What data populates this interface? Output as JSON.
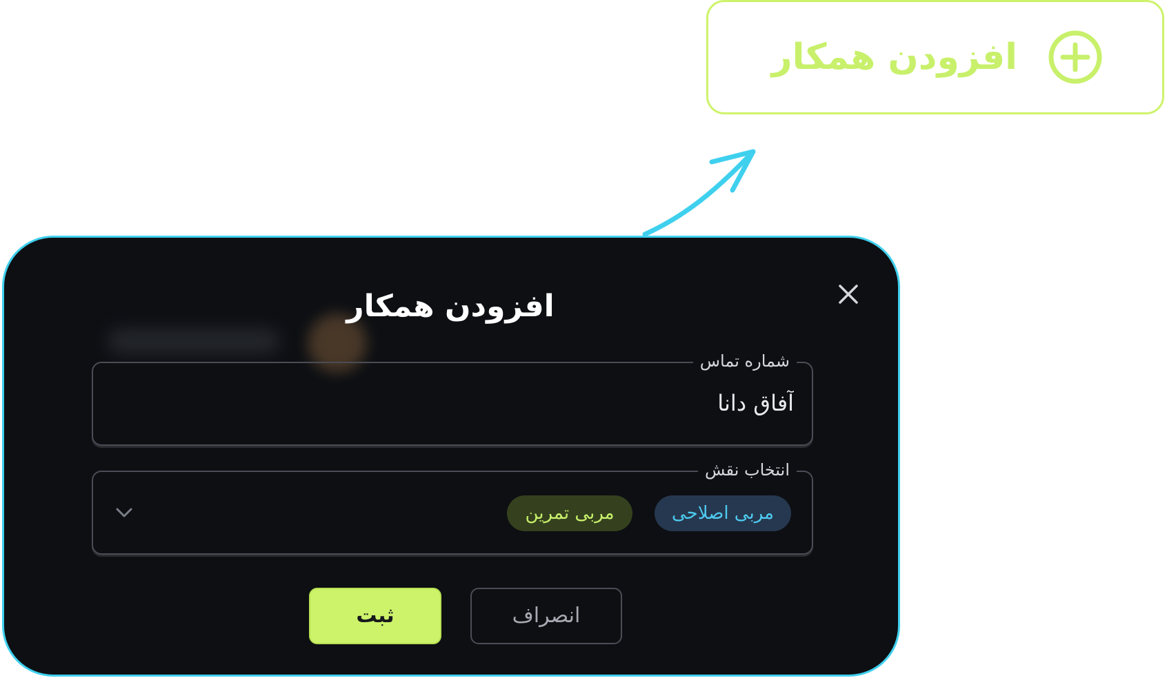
{
  "top_button": {
    "label": "افزودن همکار",
    "icon": "plus-circle-icon",
    "color": "#cdf36a"
  },
  "arrow": {
    "color": "#3fd0ee"
  },
  "modal": {
    "title": "افزودن همکار",
    "border_color": "#3fd0ee",
    "background": "#0d0f13",
    "close_icon": "close-icon",
    "phone_field": {
      "legend": "شماره تماس",
      "value": "آفاق دانا"
    },
    "role_field": {
      "legend": "انتخاب نقش",
      "chips": [
        {
          "label": "مربی اصلاحی",
          "color": "#4ecbf0"
        },
        {
          "label": "مربی تمرین",
          "color": "#c8f06b"
        }
      ],
      "dropdown_icon": "chevron-down-icon"
    },
    "buttons": {
      "submit_label": "ثبت",
      "cancel_label": "انصراف"
    }
  }
}
